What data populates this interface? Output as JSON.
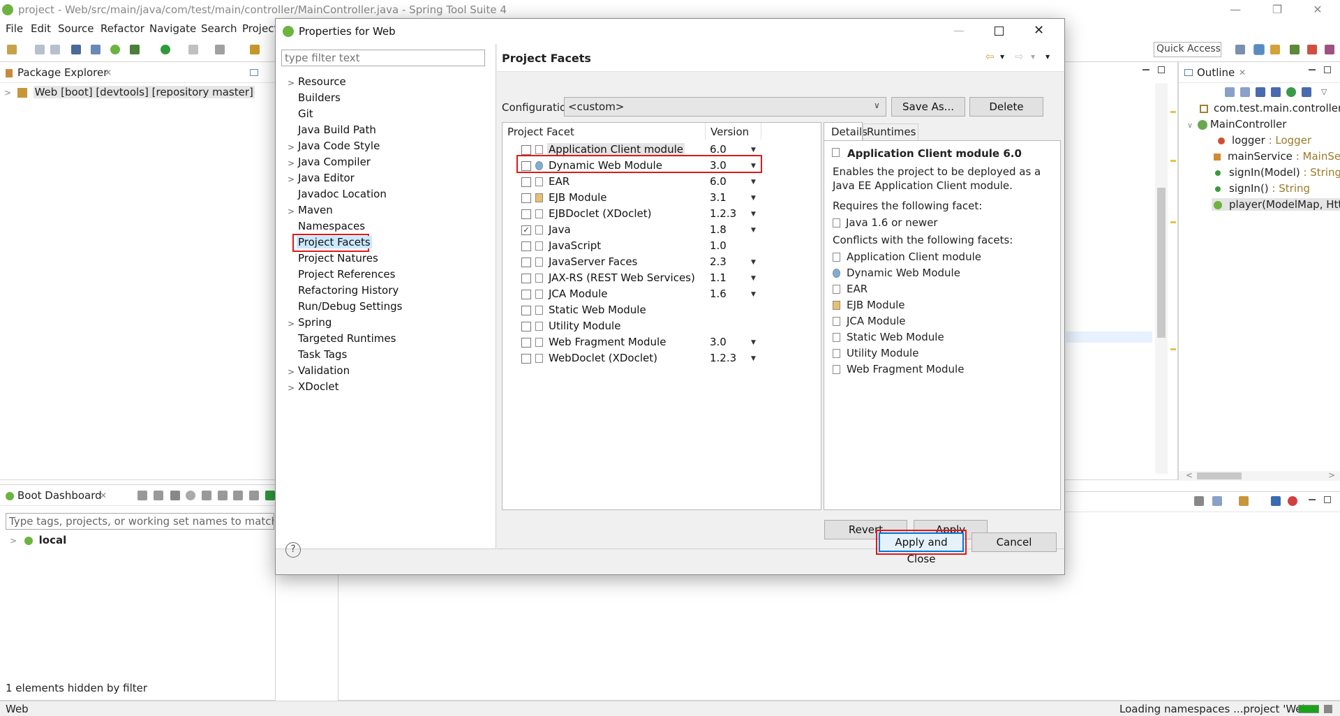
{
  "window": {
    "title": "project - Web/src/main/java/com/test/main/controller/MainController.java - Spring Tool Suite 4",
    "minimize": "—",
    "restore": "❐",
    "close": "✕"
  },
  "menu": [
    "File",
    "Edit",
    "Source",
    "Refactor",
    "Navigate",
    "Search",
    "Project"
  ],
  "quick_access": "Quick Access",
  "package_explorer": {
    "tab": "Package Explorer",
    "tab_close": "✕",
    "tree": [
      {
        "label": "Web [boot] [devtools] [repository master]"
      }
    ]
  },
  "boot_dashboard": {
    "tab": "Boot Dashboard",
    "tab_close": "✕",
    "search_placeholder": "Type tags, projects, or working set names to match (incl.",
    "tree": [
      {
        "label": "local"
      }
    ],
    "footer": "1 elements hidden by filter"
  },
  "outline": {
    "tab": "Outline",
    "tab_close": "✕",
    "items": [
      {
        "name": "com.test.main.controller",
        "type": ""
      },
      {
        "name": "MainController",
        "type": ""
      },
      {
        "name": "logger",
        "type": " : Logger"
      },
      {
        "name": "mainService",
        "type": " : MainServ"
      },
      {
        "name": "signIn(Model)",
        "type": " : String"
      },
      {
        "name": "signIn()",
        "type": " : String"
      },
      {
        "name": "player(ModelMap, Http",
        "type": ""
      }
    ]
  },
  "status_bar": {
    "left": "Web",
    "right": "Loading namespaces ...project 'Web'"
  },
  "dialog": {
    "title": "Properties for Web",
    "filter_placeholder": "type filter text",
    "nav": [
      {
        "label": "Resource",
        "expandable": true
      },
      {
        "label": "Builders",
        "expandable": false
      },
      {
        "label": "Git",
        "expandable": false
      },
      {
        "label": "Java Build Path",
        "expandable": false
      },
      {
        "label": "Java Code Style",
        "expandable": true
      },
      {
        "label": "Java Compiler",
        "expandable": true
      },
      {
        "label": "Java Editor",
        "expandable": true
      },
      {
        "label": "Javadoc Location",
        "expandable": false
      },
      {
        "label": "Maven",
        "expandable": true
      },
      {
        "label": "Namespaces",
        "expandable": false
      },
      {
        "label": "Project Facets",
        "expandable": false,
        "selected": true
      },
      {
        "label": "Project Natures",
        "expandable": false
      },
      {
        "label": "Project References",
        "expandable": false
      },
      {
        "label": "Refactoring History",
        "expandable": false
      },
      {
        "label": "Run/Debug Settings",
        "expandable": false
      },
      {
        "label": "Spring",
        "expandable": true
      },
      {
        "label": "Targeted Runtimes",
        "expandable": false
      },
      {
        "label": "Task Tags",
        "expandable": false
      },
      {
        "label": "Validation",
        "expandable": true
      },
      {
        "label": "XDoclet",
        "expandable": true
      }
    ],
    "page_title": "Project Facets",
    "configuration_label": "Configuration:",
    "configuration_value": "<custom>",
    "save_as": "Save As...",
    "delete": "Delete",
    "facet_col": "Project Facet",
    "version_col": "Version",
    "facets": [
      {
        "name": "Application Client module",
        "version": "6.0",
        "checked": false,
        "dropdown": true
      },
      {
        "name": "Dynamic Web Module",
        "version": "3.0",
        "checked": false,
        "dropdown": true
      },
      {
        "name": "EAR",
        "version": "6.0",
        "checked": false,
        "dropdown": true
      },
      {
        "name": "EJB Module",
        "version": "3.1",
        "checked": false,
        "dropdown": true
      },
      {
        "name": "EJBDoclet (XDoclet)",
        "version": "1.2.3",
        "checked": false,
        "dropdown": true
      },
      {
        "name": "Java",
        "version": "1.8",
        "checked": true,
        "dropdown": true
      },
      {
        "name": "JavaScript",
        "version": "1.0",
        "checked": false,
        "dropdown": false
      },
      {
        "name": "JavaServer Faces",
        "version": "2.3",
        "checked": false,
        "dropdown": true
      },
      {
        "name": "JAX-RS (REST Web Services)",
        "version": "1.1",
        "checked": false,
        "dropdown": true
      },
      {
        "name": "JCA Module",
        "version": "1.6",
        "checked": false,
        "dropdown": true
      },
      {
        "name": "Static Web Module",
        "version": "",
        "checked": false,
        "dropdown": false
      },
      {
        "name": "Utility Module",
        "version": "",
        "checked": false,
        "dropdown": false
      },
      {
        "name": "Web Fragment Module",
        "version": "3.0",
        "checked": false,
        "dropdown": true
      },
      {
        "name": "WebDoclet (XDoclet)",
        "version": "1.2.3",
        "checked": false,
        "dropdown": true
      }
    ],
    "details_tab": "Details",
    "runtimes_tab": "Runtimes",
    "details": {
      "heading": "Application Client module 6.0",
      "description": "Enables the project to be deployed as a Java EE Application Client module.",
      "requires_label": "Requires the following facet:",
      "requires": [
        "Java 1.6 or newer"
      ],
      "conflicts_label": "Conflicts with the following facets:",
      "conflicts": [
        "Application Client module",
        "Dynamic Web Module",
        "EAR",
        "EJB Module",
        "JCA Module",
        "Static Web Module",
        "Utility Module",
        "Web Fragment Module"
      ]
    },
    "revert": "Revert",
    "apply": "Apply",
    "apply_and_close": "Apply and Close",
    "cancel": "Cancel",
    "help": "?"
  },
  "colors": {
    "highlight": "#e01818",
    "spring_green": "#6db33f",
    "selection": "#cce8ff"
  }
}
